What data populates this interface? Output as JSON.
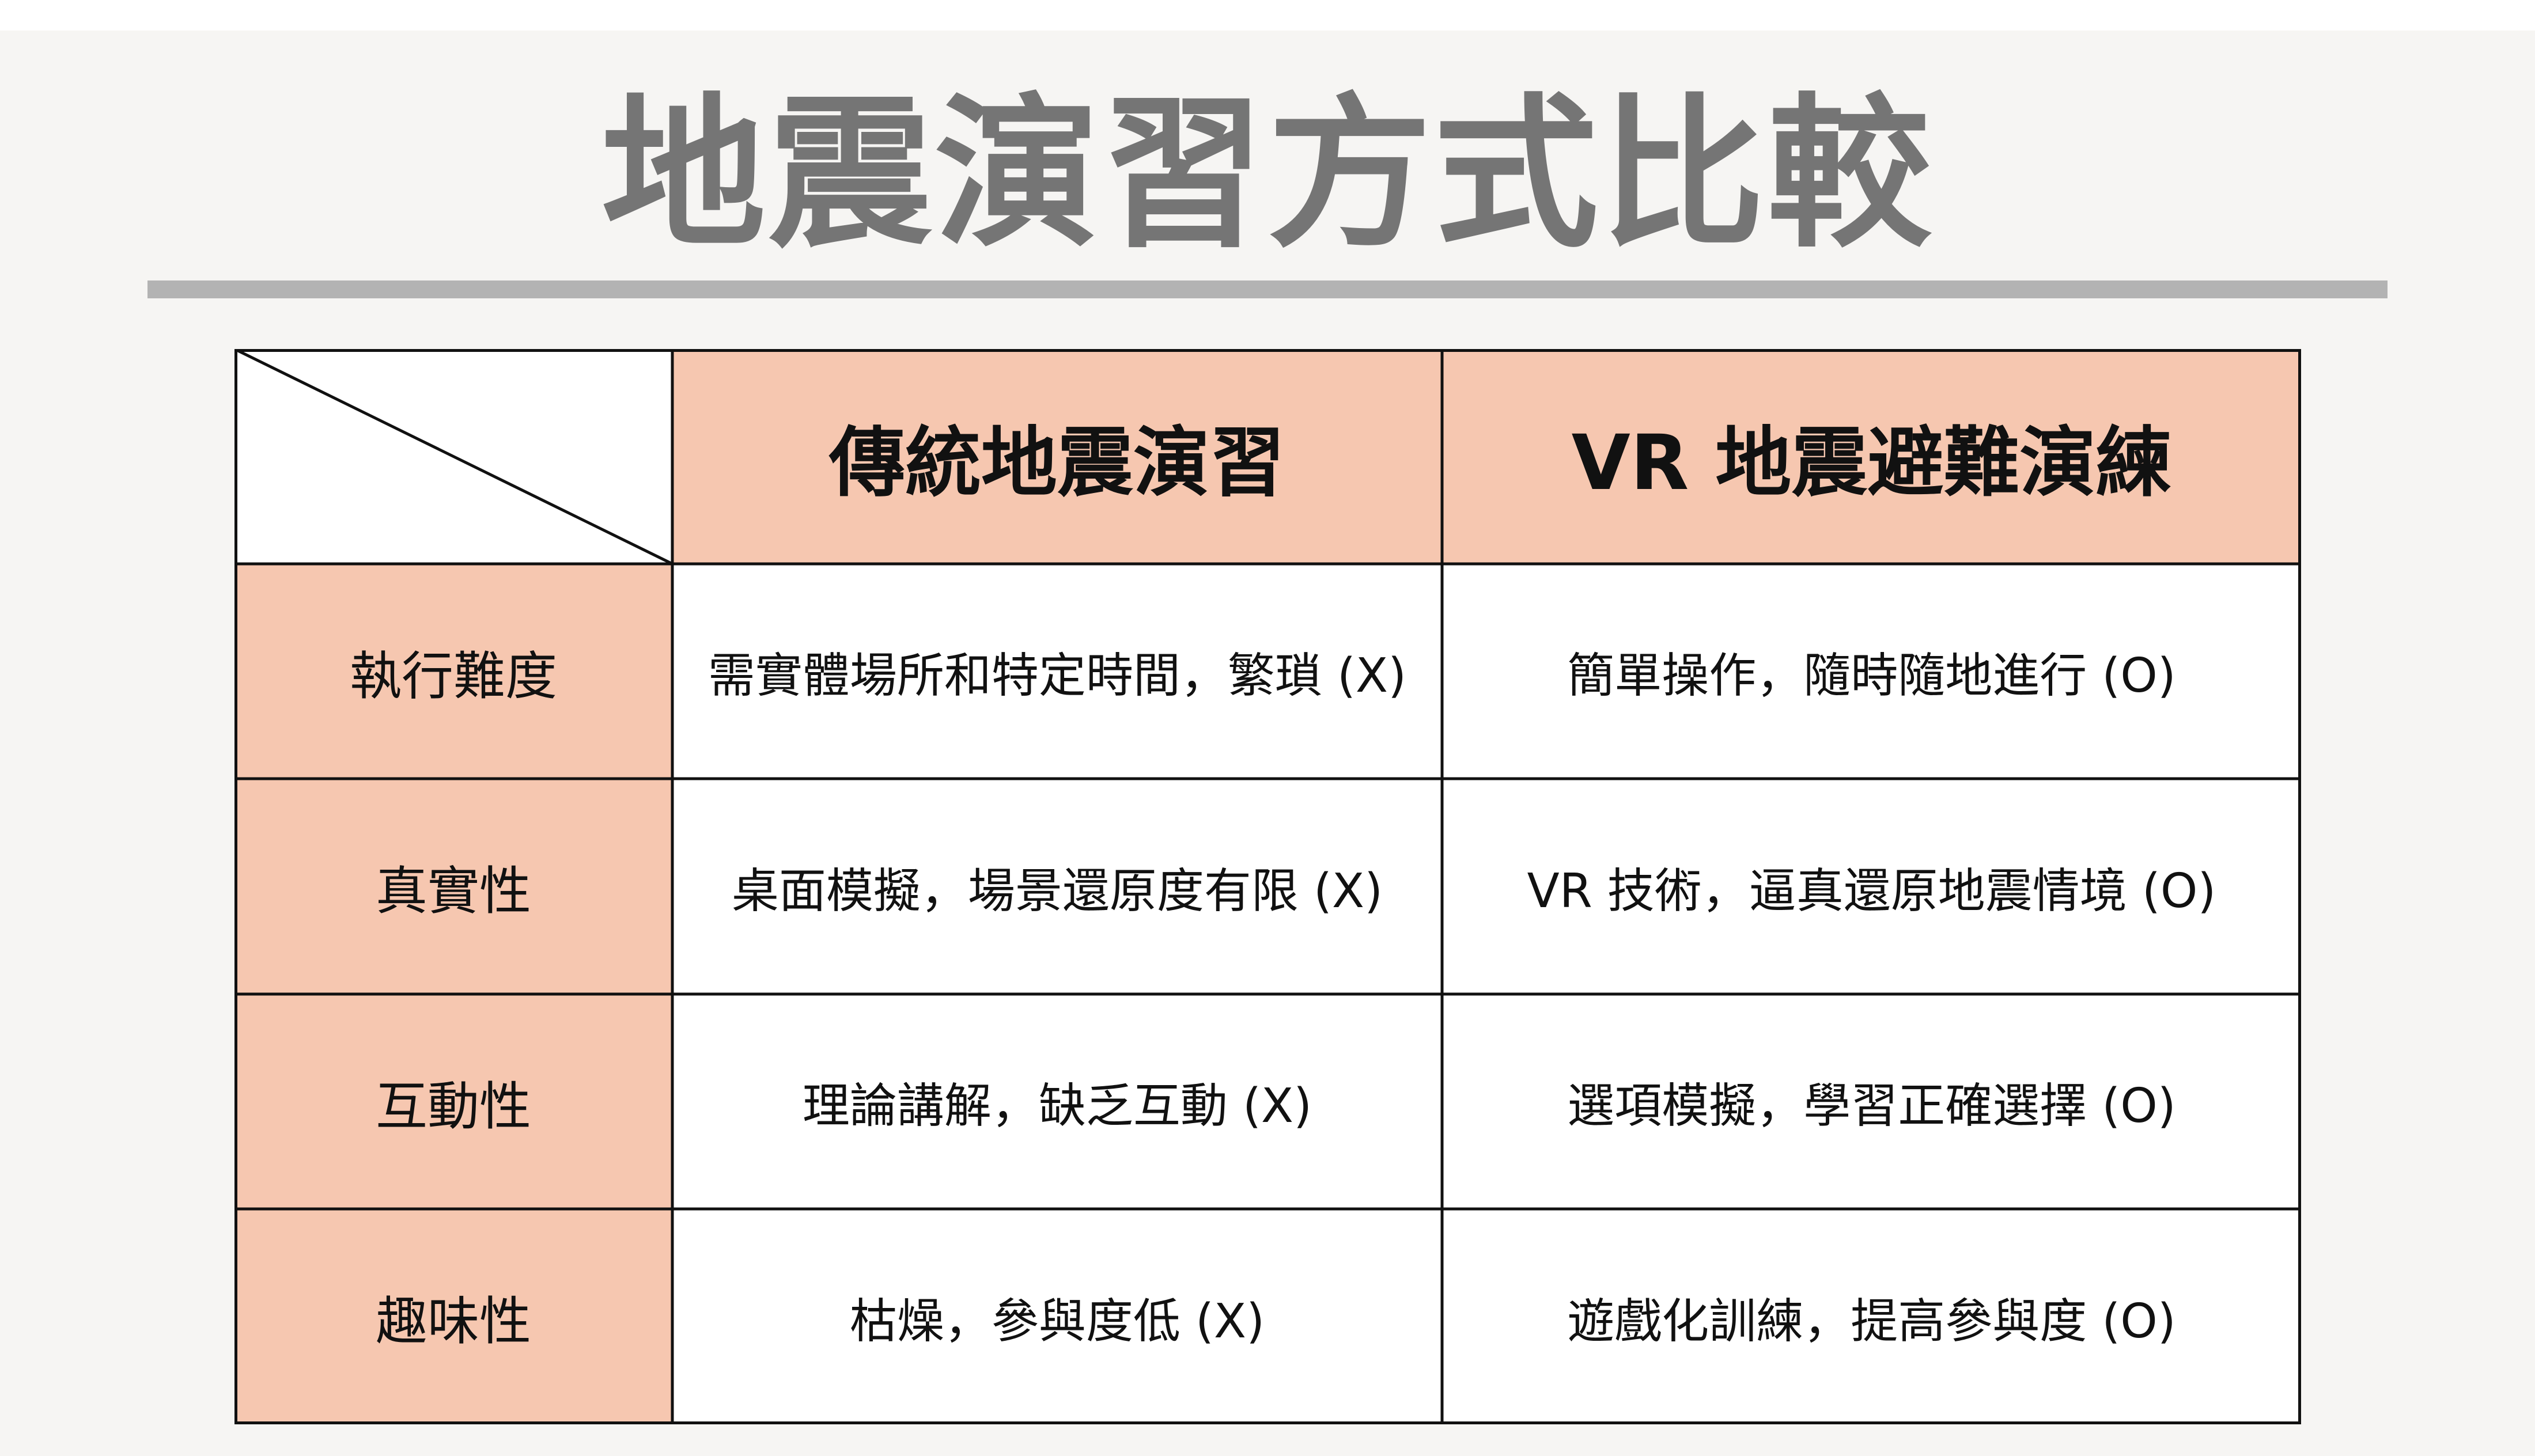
{
  "title": "地震演習方式比較",
  "table": {
    "columns": [
      "傳統地震演習",
      "VR 地震避難演練"
    ],
    "rows": [
      {
        "label": "執行難度",
        "traditional": "需實體場所和特定時間，繁瑣 (X)",
        "vr": "簡單操作，隨時隨地進行 (O)"
      },
      {
        "label": "真實性",
        "traditional": "桌面模擬，場景還原度有限 (X)",
        "vr": "VR 技術，逼真還原地震情境 (O)"
      },
      {
        "label": "互動性",
        "traditional": "理論講解，缺乏互動 (X)",
        "vr": "選項模擬，學習正確選擇 (O)"
      },
      {
        "label": "趣味性",
        "traditional": "枯燥，參與度低 (X)",
        "vr": "遊戲化訓練，提高參與度 (O)"
      }
    ]
  },
  "colors": {
    "header_fill": "#f6c7b0",
    "background": "#f6f5f3",
    "title_text": "#757575",
    "divider": "#b3b3b3"
  }
}
